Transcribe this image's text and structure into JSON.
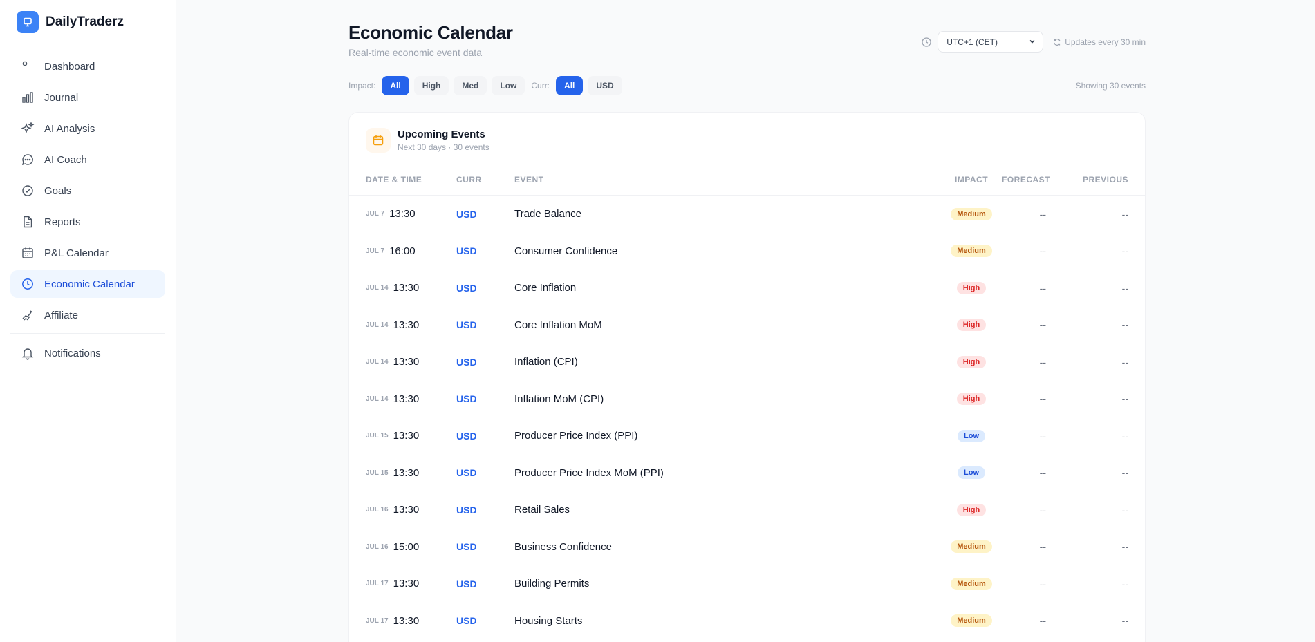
{
  "brand": {
    "name": "DailyTraderz"
  },
  "sidebar": {
    "items": [
      {
        "label": "Dashboard",
        "icon": "dot-icon"
      },
      {
        "label": "Journal",
        "icon": "bar-chart-icon"
      },
      {
        "label": "AI Analysis",
        "icon": "sparkles-icon"
      },
      {
        "label": "AI Coach",
        "icon": "chat-bubble-icon"
      },
      {
        "label": "Goals",
        "icon": "check-circle-icon"
      },
      {
        "label": "Reports",
        "icon": "document-icon"
      },
      {
        "label": "P&L Calendar",
        "icon": "calendar-icon"
      },
      {
        "label": "Economic Calendar",
        "icon": "clock-icon",
        "active": true
      },
      {
        "label": "Affiliate",
        "icon": "handshake-icon"
      },
      {
        "label": "Notifications",
        "icon": "bell-icon"
      }
    ]
  },
  "header": {
    "title": "Economic Calendar",
    "subtitle": "Real-time economic event data",
    "timezone": "UTC+1 (CET)",
    "updates": "Updates every 30 min"
  },
  "filters": {
    "impact_label": "Impact:",
    "impact_options": [
      "All",
      "High",
      "Med",
      "Low"
    ],
    "impact_selected": "All",
    "curr_label": "Curr:",
    "curr_options": [
      "All",
      "USD"
    ],
    "curr_selected": "All",
    "showing": "Showing 30 events"
  },
  "card": {
    "title": "Upcoming Events",
    "subtitle": "Next 30 days · 30 events"
  },
  "table": {
    "columns": {
      "date": "DATE & TIME",
      "curr": "CURR",
      "event": "EVENT",
      "impact": "IMPACT",
      "forecast": "FORECAST",
      "previous": "PREVIOUS"
    },
    "rows": [
      {
        "date": "JUL 7",
        "time": "13:30",
        "curr": "USD",
        "event": "Trade Balance",
        "impact": "Medium",
        "forecast": "--",
        "previous": "--"
      },
      {
        "date": "JUL 7",
        "time": "16:00",
        "curr": "USD",
        "event": "Consumer Confidence",
        "impact": "Medium",
        "forecast": "--",
        "previous": "--"
      },
      {
        "date": "JUL 14",
        "time": "13:30",
        "curr": "USD",
        "event": "Core Inflation",
        "impact": "High",
        "forecast": "--",
        "previous": "--"
      },
      {
        "date": "JUL 14",
        "time": "13:30",
        "curr": "USD",
        "event": "Core Inflation MoM",
        "impact": "High",
        "forecast": "--",
        "previous": "--"
      },
      {
        "date": "JUL 14",
        "time": "13:30",
        "curr": "USD",
        "event": "Inflation (CPI)",
        "impact": "High",
        "forecast": "--",
        "previous": "--"
      },
      {
        "date": "JUL 14",
        "time": "13:30",
        "curr": "USD",
        "event": "Inflation MoM (CPI)",
        "impact": "High",
        "forecast": "--",
        "previous": "--"
      },
      {
        "date": "JUL 15",
        "time": "13:30",
        "curr": "USD",
        "event": "Producer Price Index (PPI)",
        "impact": "Low",
        "forecast": "--",
        "previous": "--"
      },
      {
        "date": "JUL 15",
        "time": "13:30",
        "curr": "USD",
        "event": "Producer Price Index MoM (PPI)",
        "impact": "Low",
        "forecast": "--",
        "previous": "--"
      },
      {
        "date": "JUL 16",
        "time": "13:30",
        "curr": "USD",
        "event": "Retail Sales",
        "impact": "High",
        "forecast": "--",
        "previous": "--"
      },
      {
        "date": "JUL 16",
        "time": "15:00",
        "curr": "USD",
        "event": "Business Confidence",
        "impact": "Medium",
        "forecast": "--",
        "previous": "--"
      },
      {
        "date": "JUL 17",
        "time": "13:30",
        "curr": "USD",
        "event": "Building Permits",
        "impact": "Medium",
        "forecast": "--",
        "previous": "--"
      },
      {
        "date": "JUL 17",
        "time": "13:30",
        "curr": "USD",
        "event": "Housing Starts",
        "impact": "Medium",
        "forecast": "--",
        "previous": "--"
      }
    ]
  },
  "colors": {
    "accent": "#2563eb",
    "impact_high": "#dc2626",
    "impact_medium": "#b45309",
    "impact_low": "#1d4ed8"
  }
}
